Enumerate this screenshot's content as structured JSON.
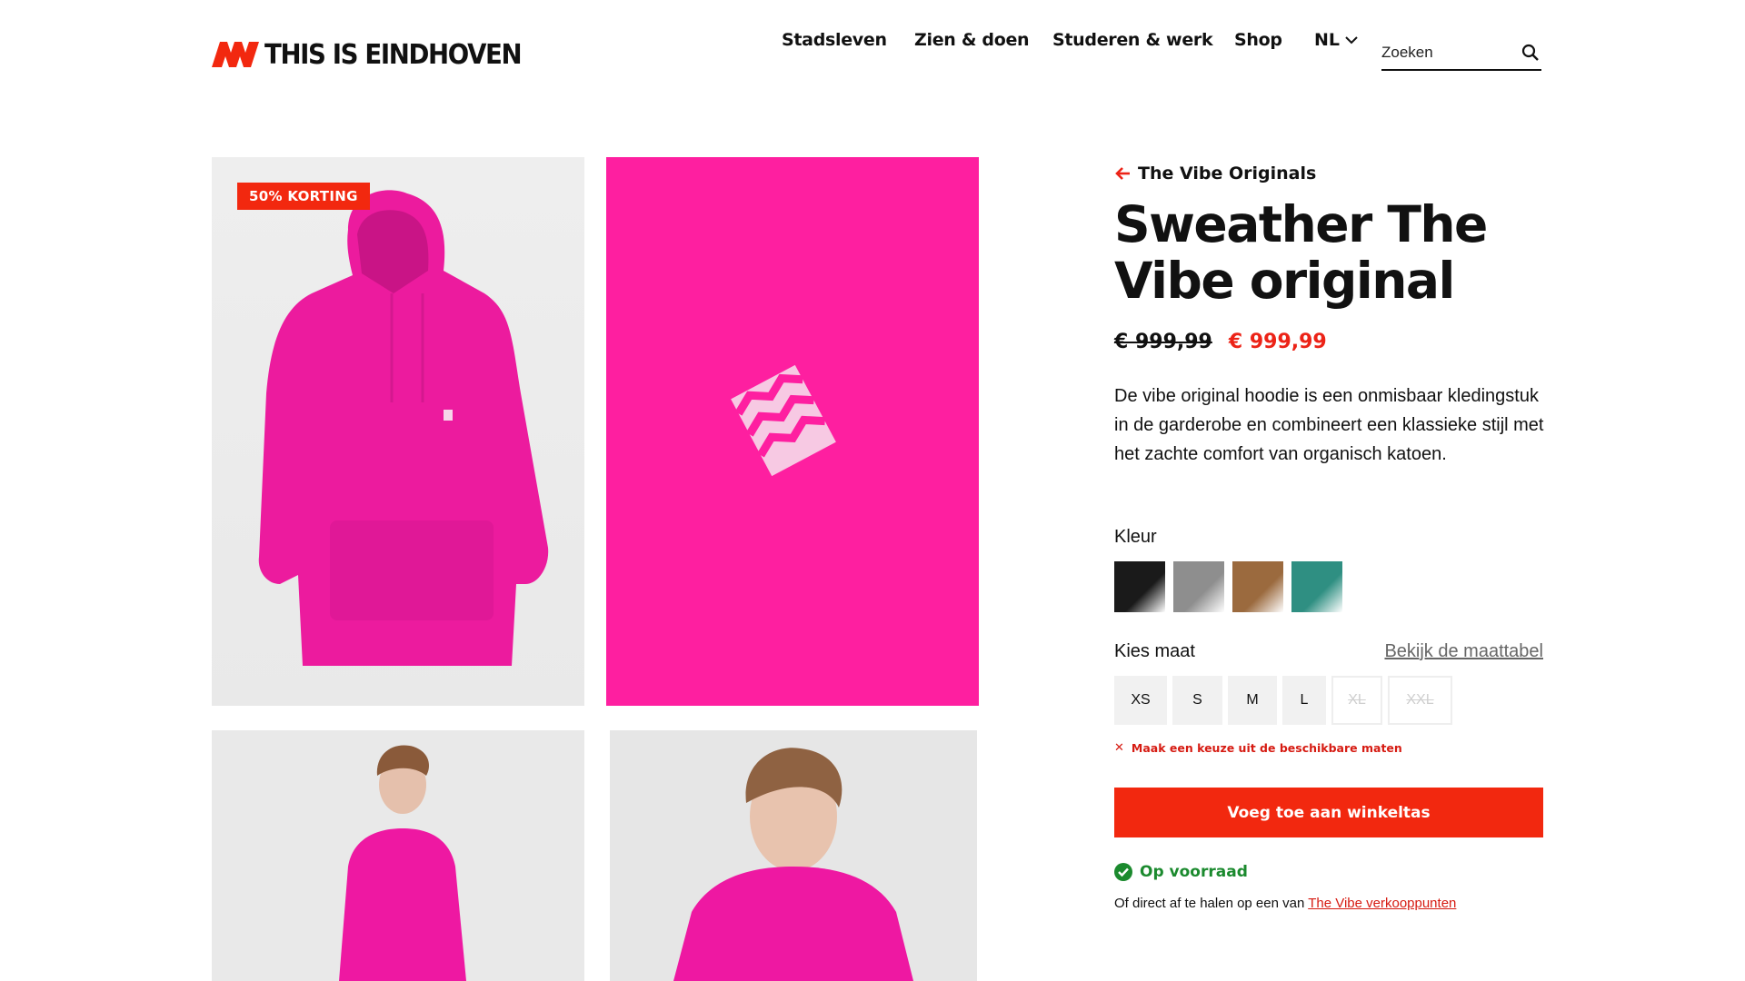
{
  "header": {
    "logo_text": "THIS IS EINDHOVEN",
    "nav": [
      "Stadsleven",
      "Zien & doen",
      "Studeren & werk",
      "Shop"
    ],
    "language": "NL",
    "search_placeholder": "Zoeken"
  },
  "gallery": {
    "badge": "50% KORTING"
  },
  "product": {
    "back_label": "The Vibe Originals",
    "title": "Sweather The Vibe original",
    "price_old": "€ 999,99",
    "price_new": "€ 999,99",
    "description": "De vibe original hoodie is een onmisbaar kledingstuk in de garderobe en combineert een klassieke stijl met het zachte comfort van organisch katoen.",
    "color_label": "Kleur",
    "colors": [
      "#1a1a1a",
      "#8e8e8e",
      "#9b6a3e",
      "#2f8f82"
    ],
    "size_label": "Kies maat",
    "size_chart_link": "Bekijk de maattabel",
    "sizes": [
      "XS",
      "S",
      "M",
      "L",
      "XL",
      "XXL"
    ],
    "sizes_available": [
      true,
      true,
      true,
      true,
      false,
      false
    ],
    "error": "Maak een keuze uit de beschikbare maten",
    "cta": "Voeg toe aan winkeltas",
    "stock": "Op voorraad",
    "pickup_text": "Of direct af te halen op een van ",
    "pickup_link": "The Vibe verkooppunten"
  },
  "colors": {
    "accent": "#f2280f",
    "product_pink": "#fe1fa0",
    "stock_green": "#1b8a2e"
  }
}
